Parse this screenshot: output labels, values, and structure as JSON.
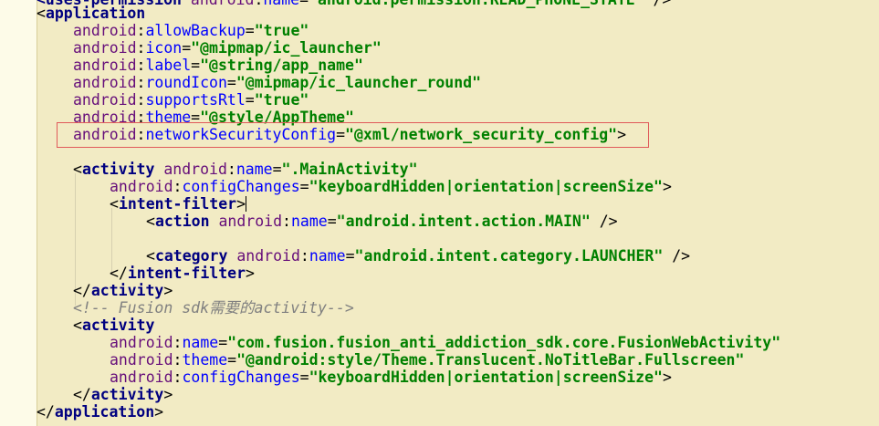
{
  "editor": {
    "colors": {
      "block_bg": "#f2ebc4",
      "tag": "#000080",
      "namespace": "#660e7a",
      "attribute": "#0000ff",
      "value": "#008000",
      "comment": "#808080",
      "highlight_border": "#e05a5a"
    },
    "line0": {
      "pre": "<uses-permission ",
      "ns": "android",
      "attr": "name",
      "eq": "=",
      "val": "\"android.permission.READ_PHONE_STATE\"",
      "close": " />"
    },
    "line1": {
      "open": "<",
      "tag": "application"
    },
    "line2": {
      "ns": "android",
      "attr": "allowBackup",
      "eq": "=",
      "val": "\"true\""
    },
    "line3": {
      "ns": "android",
      "attr": "icon",
      "eq": "=",
      "val": "\"@mipmap/ic_launcher\""
    },
    "line4": {
      "ns": "android",
      "attr": "label",
      "eq": "=",
      "val": "\"@string/app_name\""
    },
    "line5": {
      "ns": "android",
      "attr": "roundIcon",
      "eq": "=",
      "val": "\"@mipmap/ic_launcher_round\""
    },
    "line6": {
      "ns": "android",
      "attr": "supportsRtl",
      "eq": "=",
      "val": "\"true\""
    },
    "line7": {
      "ns": "android",
      "attr": "theme",
      "eq": "=",
      "val": "\"@style/AppTheme\""
    },
    "line8": {
      "ns": "android",
      "attr": "networkSecurityConfig",
      "eq": "=",
      "val": "\"@xml/network_security_config\"",
      "close": ">"
    },
    "line10": {
      "open": "<",
      "tag": "activity",
      "sp": " ",
      "ns": "android",
      "attr": "name",
      "eq": "=",
      "val": "\".MainActivity\""
    },
    "line11": {
      "ns": "android",
      "attr": "configChanges",
      "eq": "=",
      "val": "\"keyboardHidden|orientation|screenSize\"",
      "close": ">"
    },
    "line12": {
      "open": "<",
      "tag": "intent-filter",
      "close": ">"
    },
    "line13": {
      "open": "<",
      "tag": "action",
      "sp": " ",
      "ns": "android",
      "attr": "name",
      "eq": "=",
      "val": "\"android.intent.action.MAIN\"",
      "close": " />"
    },
    "line15": {
      "open": "<",
      "tag": "category",
      "sp": " ",
      "ns": "android",
      "attr": "name",
      "eq": "=",
      "val": "\"android.intent.category.LAUNCHER\"",
      "close": " />"
    },
    "line16": {
      "open": "</",
      "tag": "intent-filter",
      "close": ">"
    },
    "line17": {
      "open": "</",
      "tag": "activity",
      "close": ">"
    },
    "line18": {
      "comment": "<!-- Fusion sdk需要的activity-->"
    },
    "line19": {
      "open": "<",
      "tag": "activity"
    },
    "line20": {
      "ns": "android",
      "attr": "name",
      "eq": "=",
      "val": "\"com.fusion.fusion_anti_addiction_sdk.core.FusionWebActivity\""
    },
    "line21": {
      "ns": "android",
      "attr": "theme",
      "eq": "=",
      "val": "\"@android:style/Theme.Translucent.NoTitleBar.Fullscreen\""
    },
    "line22": {
      "ns": "android",
      "attr": "configChanges",
      "eq": "=",
      "val": "\"keyboardHidden|orientation|screenSize\"",
      "close": ">"
    },
    "line23": {
      "open": "</",
      "tag": "activity",
      "close": ">"
    },
    "line24": {
      "open": "</",
      "tag": "application",
      "close": ">"
    },
    "colon": ":"
  }
}
